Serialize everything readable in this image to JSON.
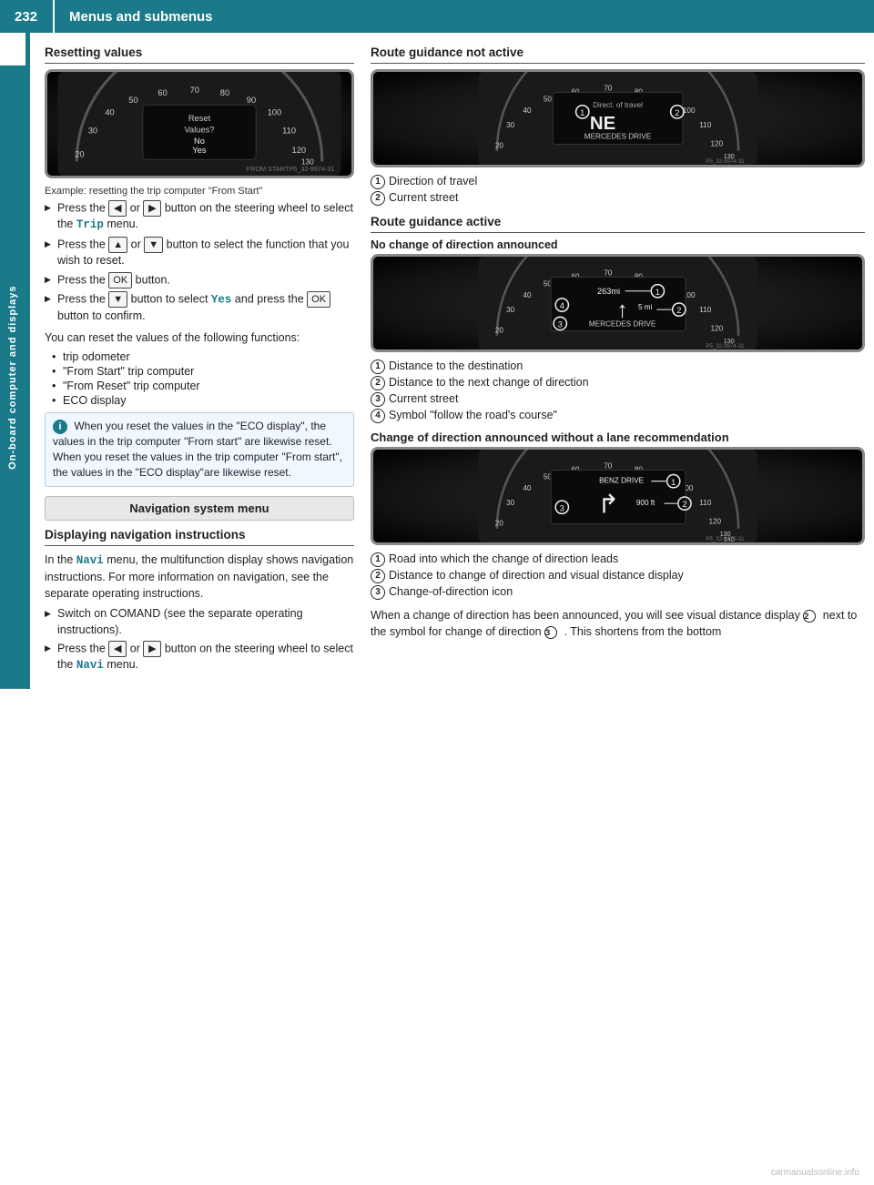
{
  "header": {
    "page_number": "232",
    "title": "Menus and submenus",
    "sidebar_label": "On-board computer and displays"
  },
  "left_column": {
    "resetting_values": {
      "title": "Resetting values",
      "speedo_caption": "Example: resetting the trip computer \"From Start\"",
      "speedo_overlay": {
        "line1": "Reset",
        "line2": "Values?",
        "line3": "No",
        "line4": "Yes",
        "footer": "FROM START"
      },
      "steps": [
        {
          "text_before": "Press the",
          "btn1": "◀",
          "middle": "or",
          "btn2": "▶",
          "text_after": "button on the steering wheel to select the",
          "menu_name": "Trip",
          "text_end": "menu."
        },
        {
          "text_before": "Press the",
          "btn1": "▲",
          "middle": "or",
          "btn2": "▼",
          "text_after": "button to select the function that you wish to reset."
        },
        {
          "text_before": "Press the",
          "btn1": "OK",
          "text_after": "button."
        },
        {
          "text_before": "Press the",
          "btn1": "▼",
          "text_after": "button to select",
          "highlight": "Yes",
          "text_end": "and press the",
          "btn2": "OK",
          "text_end2": "button to confirm."
        }
      ],
      "following_text": "You can reset the values of the following functions:",
      "bullet_items": [
        "trip odometer",
        "\"From Start\" trip computer",
        "\"From Reset\" trip computer",
        "ECO display"
      ],
      "info_text": "When you reset the values in the \"ECO display\", the values in the trip computer \"From start\" are likewise reset. When you reset the values in the trip computer \"From start\", the values in the \"ECO display\"are likewise reset."
    },
    "nav_menu": {
      "label": "Navigation system menu"
    },
    "displaying_nav": {
      "title": "Displaying navigation instructions",
      "para1": "In the",
      "menu_name": "Navi",
      "para1_end": "menu, the multifunction display shows navigation instructions. For more information on navigation, see the separate operating instructions.",
      "steps": [
        {
          "text": "Switch on COMAND (see the separate operating instructions)."
        },
        {
          "text_before": "Press the",
          "btn1": "◀",
          "middle": "or",
          "btn2": "▶",
          "text_after": "button on the steering wheel to select the",
          "menu_name": "Navi",
          "text_end": "menu."
        }
      ]
    }
  },
  "right_column": {
    "route_guidance_not_active": {
      "title": "Route guidance not active",
      "speedo_overlay": {
        "center_text": "Direct. of travel",
        "direction": "NE",
        "street": "MERCEDES DRIVE",
        "circle1": "1",
        "circle2": "2"
      },
      "annotations": [
        {
          "num": "1",
          "text": "Direction of travel"
        },
        {
          "num": "2",
          "text": "Current street"
        }
      ]
    },
    "route_guidance_active": {
      "title": "Route guidance active"
    },
    "no_change_of_direction": {
      "title": "No change of direction announced",
      "speedo_overlay": {
        "dist1": "263mi",
        "dist2": "5 mi",
        "street": "MERCEDES DRIVE",
        "circles": [
          "1",
          "2",
          "3",
          "4"
        ]
      },
      "annotations": [
        {
          "num": "1",
          "text": "Distance to the destination"
        },
        {
          "num": "2",
          "text": "Distance to the next change of direction"
        },
        {
          "num": "3",
          "text": "Current street"
        },
        {
          "num": "4",
          "text": "Symbol \"follow the road's course\""
        }
      ]
    },
    "change_of_direction": {
      "title": "Change of direction announced without a lane recommendation",
      "speedo_overlay": {
        "street": "BENZ DRIVE",
        "dist": "900 ft",
        "circles": [
          "1",
          "2",
          "3"
        ]
      },
      "annotations": [
        {
          "num": "1",
          "text": "Road into which the change of direction leads"
        },
        {
          "num": "2",
          "text": "Distance to change of direction and visual distance display"
        },
        {
          "num": "3",
          "text": "Change-of-direction icon"
        }
      ],
      "para": "When a change of direction has been announced, you will see visual distance display ② next to the symbol for change of direction ③. This shortens from the bottom"
    }
  }
}
